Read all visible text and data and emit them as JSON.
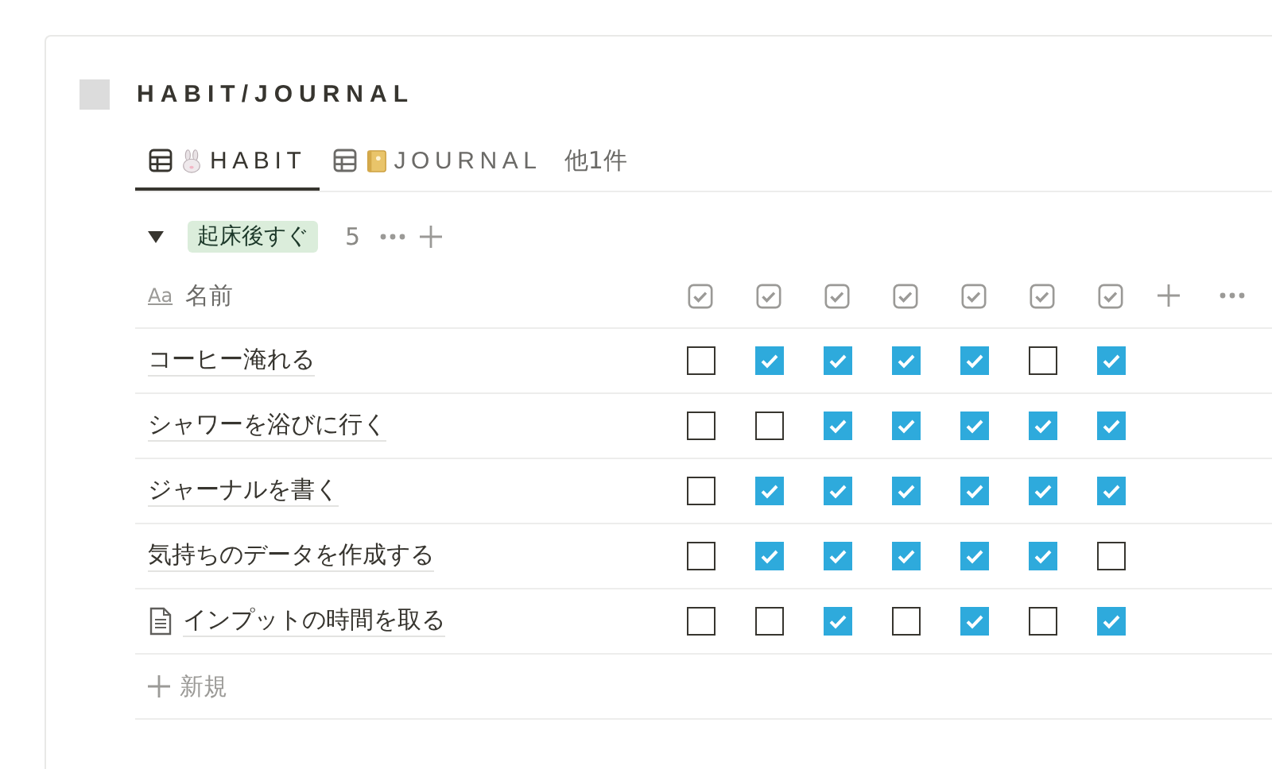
{
  "title": "HABIT/JOURNAL",
  "tabs": [
    {
      "label": "HABIT",
      "selected": true
    },
    {
      "label": "JOURNAL",
      "selected": false
    }
  ],
  "more_views": "他1件",
  "group": {
    "expanded": true,
    "label": "起床後すぐ",
    "count": "5"
  },
  "table": {
    "name_type": "Aa",
    "name_column": "名前",
    "rows": [
      {
        "name": "コーヒー淹れる",
        "page_icon": false,
        "checks": [
          false,
          true,
          true,
          true,
          true,
          false,
          true
        ]
      },
      {
        "name": "シャワーを浴びに行く",
        "page_icon": false,
        "checks": [
          false,
          false,
          true,
          true,
          true,
          true,
          true
        ]
      },
      {
        "name": "ジャーナルを書く",
        "page_icon": false,
        "checks": [
          false,
          true,
          true,
          true,
          true,
          true,
          true
        ]
      },
      {
        "name": "気持ちのデータを作成する",
        "page_icon": false,
        "checks": [
          false,
          true,
          true,
          true,
          true,
          true,
          false
        ]
      },
      {
        "name": "インプットの時間を取る",
        "page_icon": true,
        "checks": [
          false,
          false,
          true,
          false,
          true,
          false,
          true
        ]
      }
    ],
    "new_row": "新規"
  }
}
